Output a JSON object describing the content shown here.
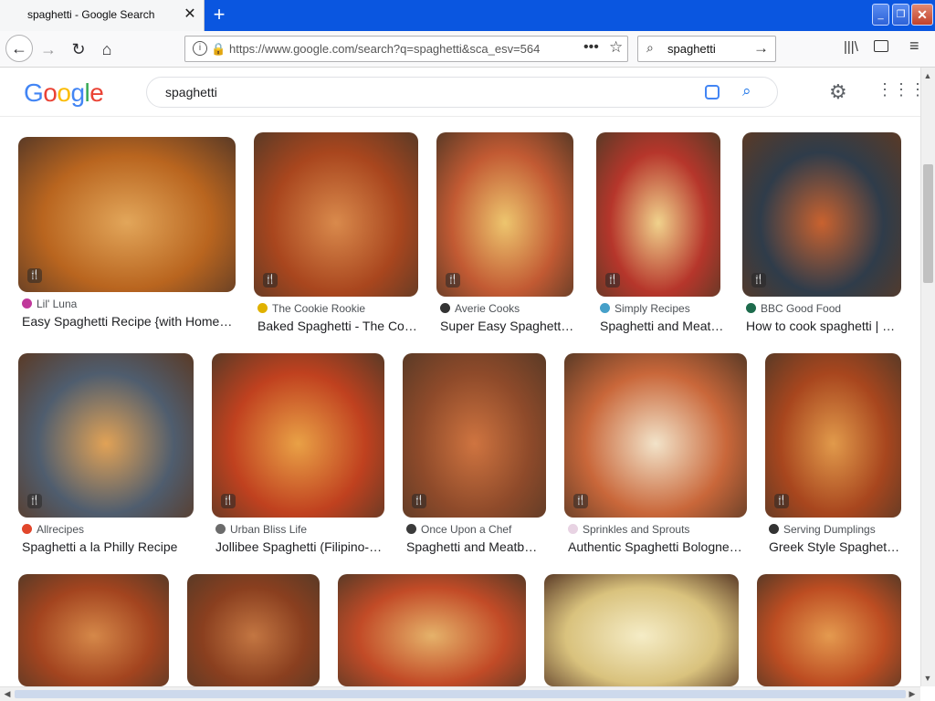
{
  "browser": {
    "tab_title": "spaghetti - Google Search",
    "url": "https://www.google.com/search?q=spaghetti&sca_esv=564",
    "search_box_value": "spaghetti"
  },
  "google": {
    "query": "spaghetti"
  },
  "colors": {
    "titlebar": "#0a56e0",
    "link_text": "#202124",
    "source_text": "#4d5156"
  },
  "results": [
    {
      "source": "Lil' Luna",
      "title": "Easy Spaghetti Recipe {with Home…",
      "fav": "#c0399b",
      "img_colors": [
        "#b9651f",
        "#e2a65a"
      ]
    },
    {
      "source": "The Cookie Rookie",
      "title": "Baked Spaghetti - The Co…",
      "fav": "#e0b100",
      "img_colors": [
        "#a9461e",
        "#d98a4c"
      ]
    },
    {
      "source": "Averie Cooks",
      "title": "Super Easy Spaghett…",
      "fav": "#333333",
      "img_colors": [
        "#c25a33",
        "#edc56e"
      ]
    },
    {
      "source": "Simply Recipes",
      "title": "Spaghetti and Meat…",
      "fav": "#46a0c9",
      "img_colors": [
        "#b6362b",
        "#f0d28c"
      ]
    },
    {
      "source": "BBC Good Food",
      "title": "How to cook spaghetti | …",
      "fav": "#1d6b4c",
      "img_colors": [
        "#2f3c4a",
        "#c9622f"
      ]
    },
    {
      "source": "Allrecipes",
      "title": "Spaghetti a la Philly Recipe",
      "fav": "#e1462b",
      "img_colors": [
        "#4f5d6e",
        "#e1a256"
      ]
    },
    {
      "source": "Urban Bliss Life",
      "title": "Jollibee Spaghetti (Filipino-…",
      "fav": "#6b6b6b",
      "img_colors": [
        "#c0411f",
        "#e9a146"
      ]
    },
    {
      "source": "Once Upon a Chef",
      "title": "Spaghetti and Meatb…",
      "fav": "#3b3b3b",
      "img_colors": [
        "#8e4a2a",
        "#cf7440"
      ]
    },
    {
      "source": "Sprinkles and Sprouts",
      "title": "Authentic Spaghetti Bologne…",
      "fav": "#e8d3e3",
      "img_colors": [
        "#c9673a",
        "#f2e3c9"
      ]
    },
    {
      "source": "Serving Dumplings",
      "title": "Greek Style Spaghet…",
      "fav": "#333333",
      "img_colors": [
        "#a8461e",
        "#e19a4b"
      ]
    },
    {
      "source": "",
      "title": "",
      "fav": "",
      "img_colors": [
        "#a3441f",
        "#d58849"
      ]
    },
    {
      "source": "",
      "title": "",
      "fav": "",
      "img_colors": [
        "#8a3f1f",
        "#c37642"
      ]
    },
    {
      "source": "",
      "title": "",
      "fav": "",
      "img_colors": [
        "#c24b27",
        "#e5b26a"
      ]
    },
    {
      "source": "",
      "title": "",
      "fav": "",
      "img_colors": [
        "#d9c27d",
        "#f5ecc6"
      ]
    },
    {
      "source": "",
      "title": "",
      "fav": "",
      "img_colors": [
        "#bd4d22",
        "#e49a4f"
      ]
    }
  ]
}
